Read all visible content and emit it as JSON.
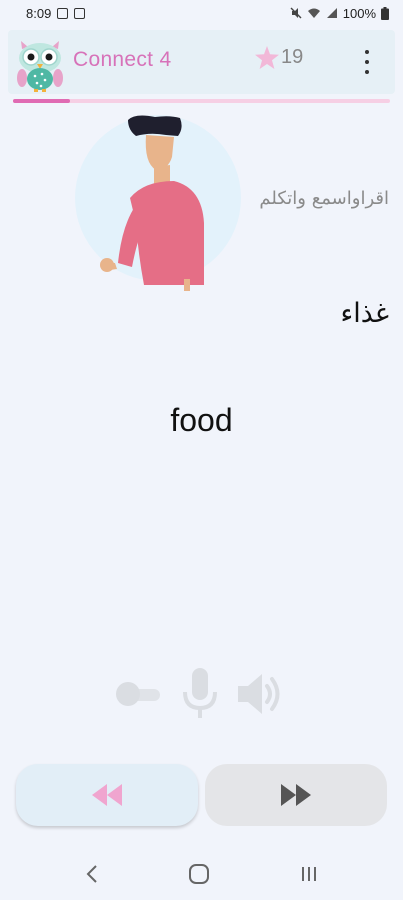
{
  "status_bar": {
    "time": "8:09",
    "battery": "100%",
    "icons": [
      "image-icon",
      "notification-icon",
      "mute-icon",
      "wifi-icon",
      "signal-icon",
      "battery-icon"
    ]
  },
  "app_bar": {
    "title": "Connect 4",
    "stars": "19",
    "logo": "owl-logo",
    "menu_icon": "more-vert-icon"
  },
  "progress": {
    "fraction": 0.15,
    "fill_color": "#e06bb3",
    "track_color": "#f6cfe4"
  },
  "lesson": {
    "instruction": "اقراواسمع واتكلم",
    "arabic_word": "غذاء",
    "english_word": "food",
    "illustration": "man-pointing-illustration"
  },
  "controls": {
    "toggle_icon": "toggle-icon",
    "mic_icon": "microphone-icon",
    "speaker_icon": "speaker-icon"
  },
  "navigation": {
    "prev_icon": "rewind-icon",
    "next_icon": "fast-forward-icon",
    "prev_color": "#f0a5cf",
    "next_color": "#555555"
  },
  "system_nav": {
    "back_icon": "back-icon",
    "home_icon": "home-icon",
    "recents_icon": "recents-icon"
  },
  "colors": {
    "accent": "#d772b9",
    "background": "#f1f4fb",
    "app_bar": "#e6f0f6"
  }
}
